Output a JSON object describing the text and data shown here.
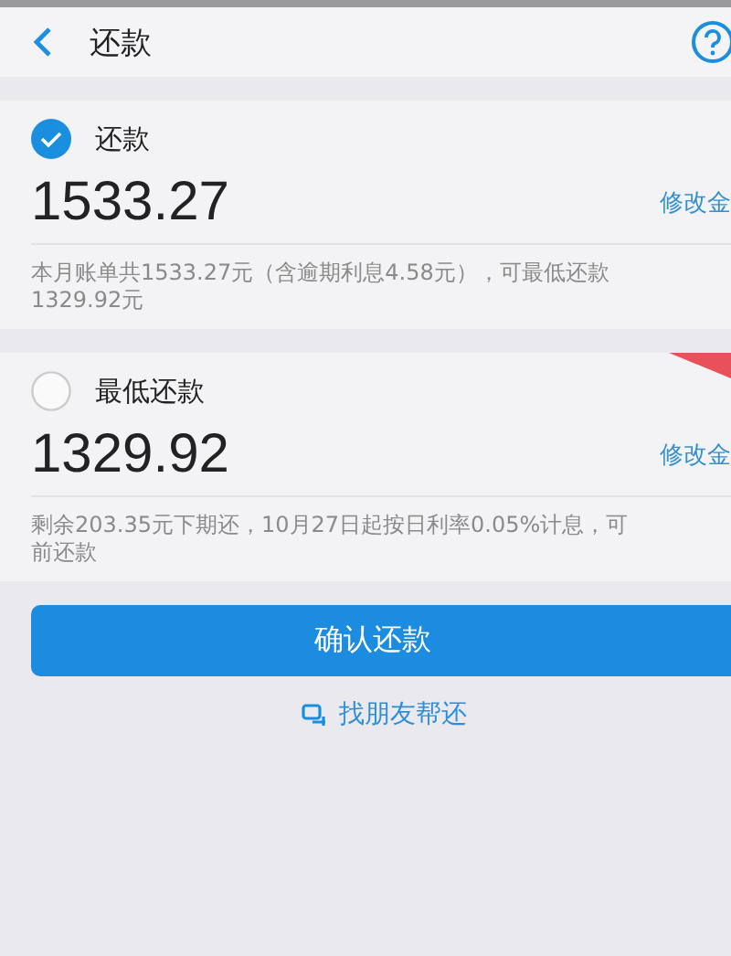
{
  "header": {
    "title": "还款"
  },
  "options": [
    {
      "label": "还款",
      "selected": true,
      "amount": "1533.27",
      "edit_link": "修改金",
      "description_lines": [
        "本月账单共1533.27元（含逾期利息4.58元），可最低还款",
        "1329.92元"
      ],
      "corner_badge": false
    },
    {
      "label": "最低还款",
      "selected": false,
      "amount": "1329.92",
      "edit_link": "修改金",
      "description_lines": [
        "剩余203.35元下期还，10月27日起按日利率0.05%计息，可",
        "前还款"
      ],
      "corner_badge": true
    }
  ],
  "confirm_button": "确认还款",
  "friend_link": "找朋友帮还"
}
